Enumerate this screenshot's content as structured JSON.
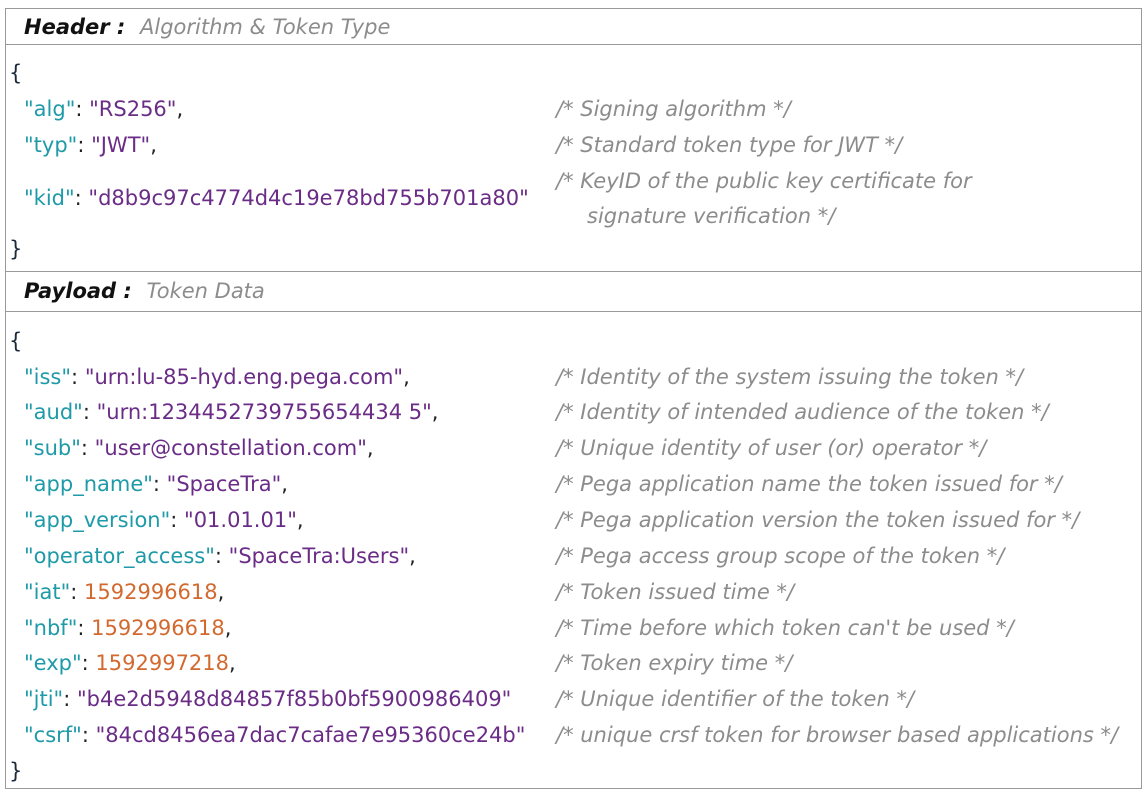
{
  "header": {
    "title_key": "Header :",
    "title_sub": "Algorithm & Token Type",
    "open_brace": "{",
    "close_brace": "}",
    "rows": [
      {
        "key": "\"alg\"",
        "sep": ": ",
        "value": "\"RS256\"",
        "type": "s",
        "tail": ",",
        "comment": "/* Signing algorithm */"
      },
      {
        "key": "\"typ\"",
        "sep": ": ",
        "value": "\"JWT\"",
        "type": "s",
        "tail": ",",
        "comment": "/* Standard token type for JWT  */"
      },
      {
        "key": "\"kid\"",
        "sep": ": ",
        "value": "\"d8b9c97c4774d4c19e78bd755b701a80\"",
        "type": "s",
        "tail": "",
        "comment": "/*  KeyID of the public key certificate for",
        "comment2": "signature verification */"
      }
    ]
  },
  "payload": {
    "title_key": "Payload :",
    "title_sub": "Token Data",
    "open_brace": "{",
    "close_brace": "}",
    "rows": [
      {
        "key": "\"iss\"",
        "sep": ": ",
        "value": "\"urn:lu-85-hyd.eng.pega.com\"",
        "type": "s",
        "tail": ",",
        "comment": "/* Identity of the system issuing  the token */"
      },
      {
        "key": "\"aud\"",
        "sep": ": ",
        "value": "\"urn:1234452739755654434 5\"",
        "type": "s",
        "tail": ",",
        "comment": "/* Identity of intended audience of the token  */"
      },
      {
        "key": "\"sub\"",
        "sep": ": ",
        "value": "\"user@constellation.com\"",
        "type": "s",
        "tail": ",",
        "comment": "/*  Unique identity of user (or) operator */"
      },
      {
        "key": "\"app_name\"",
        "sep": ": ",
        "value": "\"SpaceTra\"",
        "type": "s",
        "tail": ",",
        "comment": "/*  Pega application name the token issued for */"
      },
      {
        "key": "\"app_version\"",
        "sep": ": ",
        "value": "\"01.01.01\"",
        "type": "s",
        "tail": ",",
        "comment": "/* Pega application version the token issued for  */"
      },
      {
        "key": "\"operator_access\"",
        "sep": ": ",
        "value": "\"SpaceTra:Users\"",
        "type": "s",
        "tail": ",",
        "comment": "/* Pega access group scope of the token */"
      },
      {
        "key": "\"iat\"",
        "sep": ": ",
        "value": "1592996618",
        "type": "n",
        "tail": ",",
        "comment": "/*  Token issued time */"
      },
      {
        "key": "\"nbf\"",
        "sep": ": ",
        "value": "1592996618",
        "type": "n",
        "tail": ",",
        "comment": "/*  Time before which token can't be used */"
      },
      {
        "key": "\"exp\"",
        "sep": ": ",
        "value": "1592997218",
        "type": "n",
        "tail": ",",
        "comment": "/*  Token expiry time */"
      },
      {
        "key": "\"jti\"",
        "sep": ": ",
        "value": "\"b4e2d5948d84857f85b0bf5900986409\"",
        "type": "s",
        "tail": "",
        "comment": "/* Unique identifier of the token */"
      },
      {
        "key": "\"csrf\"",
        "sep": ": ",
        "value": "\"84cd8456ea7dac7cafae7e95360ce24b\"",
        "type": "s",
        "tail": "",
        "comment": "/* unique crsf token for browser based  applications */"
      }
    ]
  }
}
